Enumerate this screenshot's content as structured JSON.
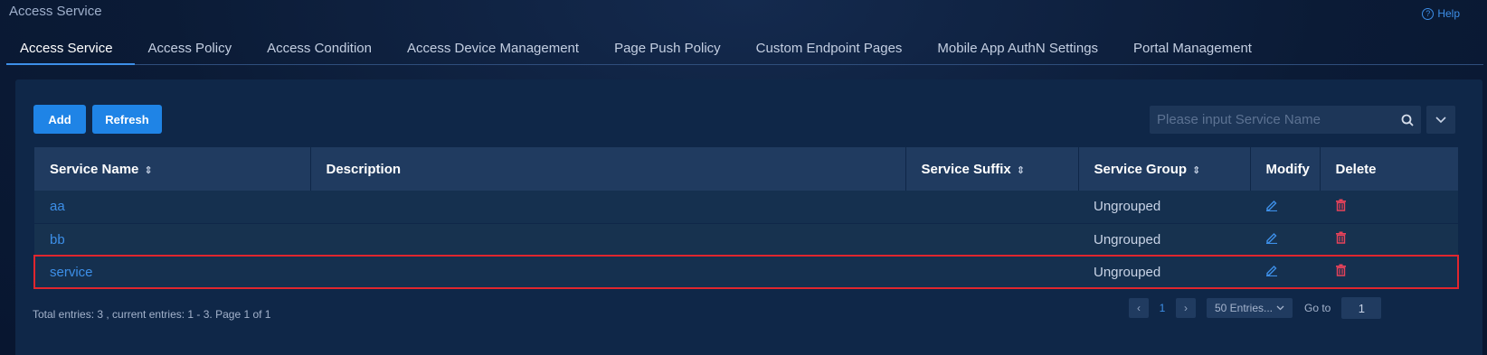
{
  "header": {
    "title": "Access Service",
    "help_label": "Help"
  },
  "tabs": [
    {
      "label": "Access Service",
      "active": true
    },
    {
      "label": "Access Policy"
    },
    {
      "label": "Access Condition"
    },
    {
      "label": "Access Device Management"
    },
    {
      "label": "Page Push Policy"
    },
    {
      "label": "Custom Endpoint Pages"
    },
    {
      "label": "Mobile App AuthN Settings"
    },
    {
      "label": "Portal Management"
    }
  ],
  "toolbar": {
    "add_label": "Add",
    "refresh_label": "Refresh",
    "search_placeholder": "Please input Service Name",
    "search_value": ""
  },
  "table": {
    "columns": [
      "Service Name",
      "Description",
      "Service Suffix",
      "Service Group",
      "Modify",
      "Delete"
    ],
    "rows": [
      {
        "name": "aa",
        "description": "",
        "suffix": "",
        "group": "Ungrouped"
      },
      {
        "name": "bb",
        "description": "",
        "suffix": "",
        "group": "Ungrouped"
      },
      {
        "name": "service",
        "description": "",
        "suffix": "",
        "group": "Ungrouped",
        "highlighted": true
      }
    ]
  },
  "footer": {
    "summary": "Total entries: 3 , current entries: 1 - 3. Page 1 of 1",
    "current_page": "1",
    "page_size": "50 Entries...",
    "goto_label": "Go to",
    "goto_value": "1"
  },
  "colors": {
    "accent": "#1f84e6",
    "link": "#3d8fe8",
    "delete": "#e8425a",
    "highlight_border": "#e0262e"
  }
}
